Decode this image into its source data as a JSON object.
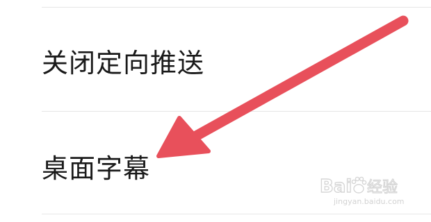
{
  "settings_list": {
    "items": [
      {
        "label": "关闭定向推送"
      },
      {
        "label": "桌面字幕"
      }
    ]
  },
  "annotation": {
    "arrow_color": "#e8505b",
    "icon": "pointer-arrow-icon"
  },
  "watermark": {
    "logo_text": "Bai经验",
    "url": "jingyan.baidu.com",
    "icon": "baidu-paw-icon"
  },
  "colors": {
    "divider": "#e6e6e6",
    "text": "#1a1a1a",
    "watermark": "#d2d2d2"
  }
}
